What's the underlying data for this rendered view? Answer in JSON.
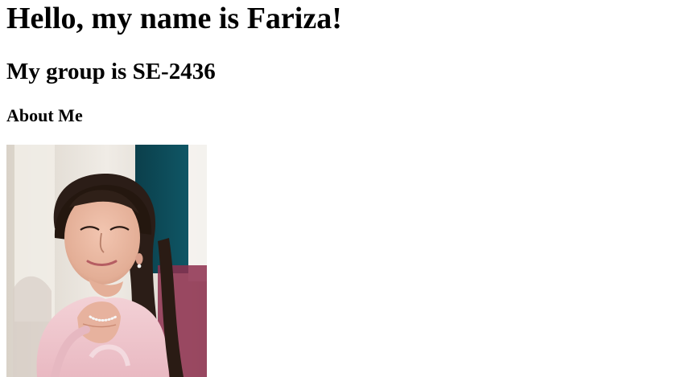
{
  "page": {
    "heading_name": "Hello, my name is Fariza!",
    "heading_group": "My group is SE-2436",
    "heading_about": "About Me"
  },
  "photo": {
    "alt": "Portrait photo",
    "colors": {
      "background_light": "#e9e3da",
      "curtain_teal": "#0d4a57",
      "hair": "#2b1d17",
      "skin": "#e6b8a1",
      "sweater_pink": "#efc8cf",
      "chair_magenta": "#8d2f4d"
    }
  }
}
